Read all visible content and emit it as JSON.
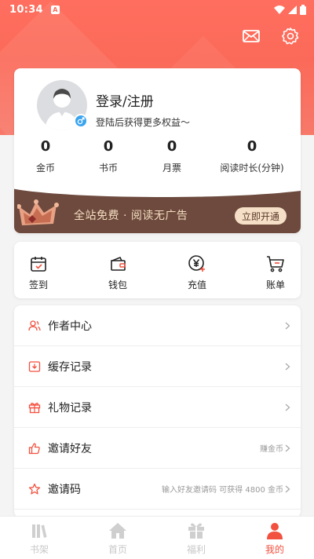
{
  "status_bar": {
    "time": "10:34",
    "notif_letter": "A"
  },
  "header": {
    "mail_icon": "mail-icon",
    "settings_icon": "gear-icon"
  },
  "profile": {
    "title": "登录/注册",
    "subtitle": "登陆后获得更多权益～",
    "gender_icon": "male-icon",
    "stats": [
      {
        "value": "0",
        "label": "金币"
      },
      {
        "value": "0",
        "label": "书币"
      },
      {
        "value": "0",
        "label": "月票"
      },
      {
        "value": "0",
        "label": "阅读时长(分钟)"
      }
    ]
  },
  "vip": {
    "text": "全站免费 · 阅读无广告",
    "button": "立即开通"
  },
  "quick_actions": [
    {
      "label": "签到",
      "icon": "calendar-check-icon"
    },
    {
      "label": "钱包",
      "icon": "wallet-icon"
    },
    {
      "label": "充值",
      "icon": "yen-plus-icon"
    },
    {
      "label": "账单",
      "icon": "cart-icon"
    }
  ],
  "menu": [
    {
      "label": "作者中心",
      "icon": "author-icon",
      "right": ""
    },
    {
      "label": "缓存记录",
      "icon": "download-icon",
      "right": ""
    },
    {
      "label": "礼物记录",
      "icon": "gift-icon",
      "right": ""
    },
    {
      "label": "邀请好友",
      "icon": "thumbs-up-icon",
      "right": "赚金币"
    },
    {
      "label": "邀请码",
      "icon": "star-icon",
      "right": "输入好友邀请码 可获得 4800 金币"
    }
  ],
  "bottom_nav": [
    {
      "label": "书架",
      "icon": "bookshelf-icon",
      "active": false
    },
    {
      "label": "首页",
      "icon": "home-icon",
      "active": false
    },
    {
      "label": "福利",
      "icon": "gift-icon",
      "active": false
    },
    {
      "label": "我的",
      "icon": "person-icon",
      "active": true
    }
  ],
  "colors": {
    "accent": "#f2513f",
    "header": "#fb6a59",
    "vip_bg": "#6d4a3d",
    "vip_text": "#f3dcc1"
  }
}
